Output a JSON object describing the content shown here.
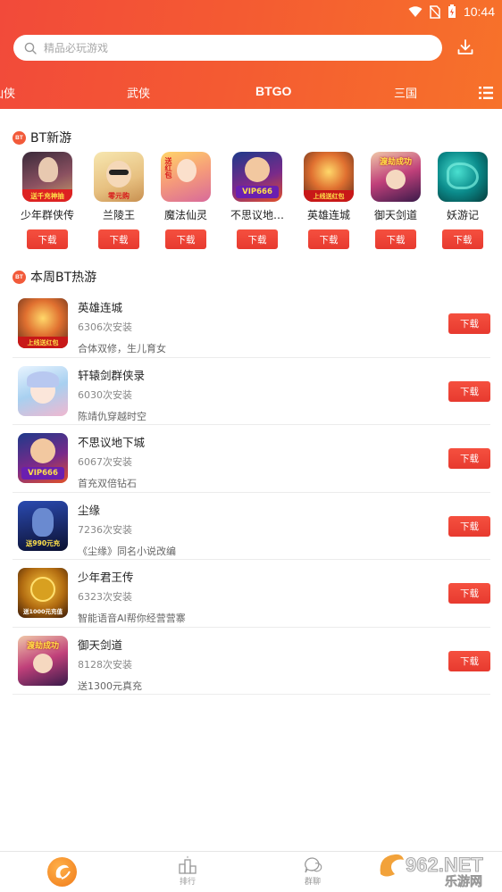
{
  "status": {
    "time": "10:44"
  },
  "search": {
    "placeholder": "精品必玩游戏"
  },
  "tabs": [
    {
      "label": "仙侠"
    },
    {
      "label": "武侠"
    },
    {
      "label": "BTGO"
    },
    {
      "label": "三国"
    }
  ],
  "new_games": {
    "badge": "BT",
    "title": "BT新游",
    "items": [
      {
        "name": "少年群侠传",
        "button": "下载",
        "icon_text": "送千充神抽"
      },
      {
        "name": "兰陵王",
        "button": "下载",
        "icon_text": "零元购"
      },
      {
        "name": "魔法仙灵",
        "button": "下载",
        "icon_text": "送红包"
      },
      {
        "name": "不思议地…",
        "button": "下载",
        "icon_text": "VIP666"
      },
      {
        "name": "英雄连城",
        "button": "下载",
        "icon_text": "上线送红包"
      },
      {
        "name": "御天剑道",
        "button": "下载",
        "icon_text": "渡劫成功"
      },
      {
        "name": "妖游记",
        "button": "下载",
        "icon_text": ""
      }
    ]
  },
  "hot_games": {
    "badge": "BT",
    "title": "本周BT热游",
    "items": [
      {
        "title": "英雄连城",
        "installs": "6306次安装",
        "desc": "合体双修，生儿育女",
        "button": "下载",
        "icon_text": "上线送红包"
      },
      {
        "title": "轩辕剑群侠录",
        "installs": "6030次安装",
        "desc": "陈靖仇穿越时空",
        "button": "下载",
        "icon_text": ""
      },
      {
        "title": "不思议地下城",
        "installs": "6067次安装",
        "desc": "首充双倍钻石",
        "button": "下载",
        "icon_text": "VIP666"
      },
      {
        "title": "尘缘",
        "installs": "7236次安装",
        "desc": "《尘缘》同名小说改编",
        "button": "下载",
        "icon_text": "送990元充"
      },
      {
        "title": "少年君王传",
        "installs": "6323次安装",
        "desc": "智能语音AI帮你经营营寨",
        "button": "下载",
        "icon_text": "送1000元充值"
      },
      {
        "title": "御天剑道",
        "installs": "8128次安装",
        "desc": "送1300元真充",
        "button": "下载",
        "icon_text": "渡劫成功"
      }
    ]
  },
  "bottom_nav": [
    {
      "label": ""
    },
    {
      "label": "排行"
    },
    {
      "label": "群聊"
    }
  ],
  "watermark": {
    "main": "962.NET",
    "sub": "乐游网"
  },
  "colors": {
    "accent": "#f24a3a",
    "button": "#e83b30"
  }
}
